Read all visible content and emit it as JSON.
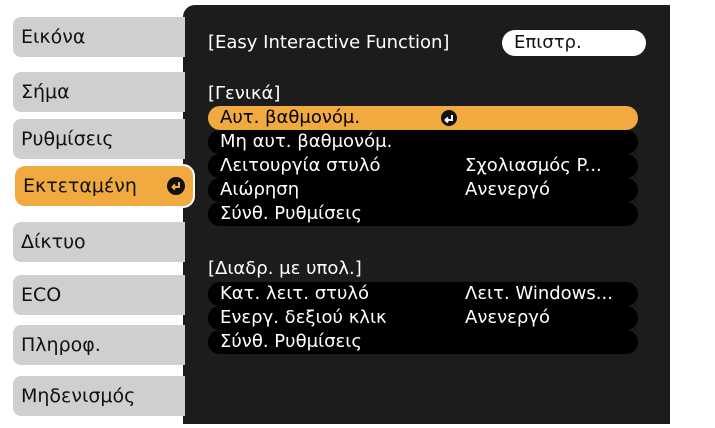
{
  "sidebar": {
    "items": [
      {
        "label": "Εικόνα"
      },
      {
        "label": "Σήμα"
      },
      {
        "label": "Ρυθμίσεις"
      },
      {
        "label": "Εκτεταμένη"
      },
      {
        "label": "Δίκτυο"
      },
      {
        "label": "ECO"
      },
      {
        "label": "Πληροφ."
      },
      {
        "label": "Μηδενισμός"
      }
    ],
    "active_index": 3
  },
  "header": {
    "title": "[Easy Interactive Function]",
    "back_label": "Επιστρ."
  },
  "sections": [
    {
      "label": "[Γενικά]",
      "rows": [
        {
          "label": "Αυτ. βαθμονόμ.",
          "value": "",
          "highlighted": true
        },
        {
          "label": "Μη αυτ. βαθμονόμ.",
          "value": ""
        },
        {
          "label": "Λειτουργία στυλό",
          "value": "Σχολιασμός P..."
        },
        {
          "label": "Αιώρηση",
          "value": "Ανενεργό"
        },
        {
          "label": "Σύνθ. Ρυθμίσεις",
          "value": ""
        }
      ]
    },
    {
      "label": "[Διαδρ. με υπολ.]",
      "rows": [
        {
          "label": "Κατ. λειτ. στυλό",
          "value": "Λειτ. Windows..."
        },
        {
          "label": "Ενεργ. δεξιού κλικ",
          "value": "Ανενεργό"
        },
        {
          "label": "Σύνθ. Ρυθμίσεις",
          "value": ""
        }
      ]
    }
  ],
  "colors": {
    "accent": "#f0aa40",
    "panel": "#1c1c1c",
    "menu": "#cfcfcf"
  }
}
